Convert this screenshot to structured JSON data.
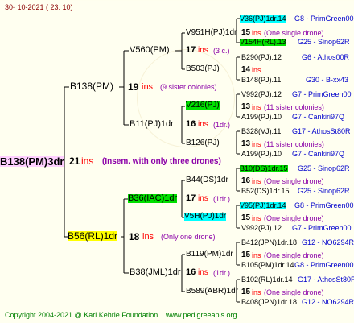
{
  "header": {
    "date": "30- 10-2021 ( 23: 10)"
  },
  "footer": {
    "copyright": "Copyright 2004-2021 @ Karl Kehrle Foundation",
    "site": "www.pedigreeapis.org"
  },
  "root": {
    "name": "B138(PM)3dr",
    "num": "21",
    "ins": "ins",
    "note": "(Insem. with only three drones)"
  },
  "gen1": {
    "father": {
      "name": "B138(PM)",
      "num": "19",
      "ins": "ins",
      "note": "(9 sister colonies)"
    },
    "mother": {
      "name": "B56(RL)1dr",
      "num": "18",
      "ins": "ins",
      "note": "(Only one drone)"
    }
  },
  "gen2": {
    "ff": {
      "name": "V560(PM)",
      "num": "17",
      "ins": "ins",
      "note": "(3 c.)"
    },
    "fm": {
      "name": "B11(PJ)1dr",
      "num": "16",
      "ins": "ins",
      "note": "(1dr.)"
    },
    "mf": {
      "name": "B36(IAC)1dr",
      "num": "17",
      "ins": "ins",
      "note": "(1dr.)"
    },
    "mm": {
      "name": "B38(JML)1dr",
      "num": "16",
      "ins": "ins",
      "note": "(1dr.)"
    }
  },
  "gen3": {
    "a": {
      "name": "V951H(PJ)1dr",
      "num": "15",
      "ins": "ins",
      "note": "(One single drone)"
    },
    "b": {
      "name": "B503(PJ)",
      "num": "14",
      "ins": "ins",
      "note": ""
    },
    "c": {
      "name": "V216(PJ)",
      "num": "13",
      "ins": "ins",
      "note": "(11 sister colonies)"
    },
    "d": {
      "name": "B126(PJ)",
      "num": "13",
      "ins": "ins",
      "note": "(11 sister colonies)"
    },
    "e": {
      "name": "B44(DS)1dr",
      "num": "16",
      "ins": "ins",
      "note": "(One single drone)"
    },
    "f": {
      "name": "V5H(PJ)1dr",
      "num": "15",
      "ins": "ins",
      "note": "(One single drone)"
    },
    "g": {
      "name": "B119(PM)1dr",
      "num": "15",
      "ins": "ins",
      "note": "(One single drone)"
    },
    "h": {
      "name": "B589(ABR)1dr",
      "num": "15",
      "ins": "ins",
      "note": "(One single drone)"
    }
  },
  "gen4": [
    {
      "name": "V36(PJ)1dr.14",
      "org": "G8 - PrimGreen00"
    },
    {
      "name": "V154H(RL).13",
      "org": "G25 - Sinop62R"
    },
    {
      "name": "B290(PJ).12",
      "org": "G6 - Athos00R"
    },
    {
      "name": "B148(PJ).11",
      "org": "G30 - B-xx43"
    },
    {
      "name": "V992(PJ).12",
      "org": "G7 - PrimGreen00"
    },
    {
      "name": "A199(PJ).10",
      "org": "G7 - Cankiri97Q"
    },
    {
      "name": "B328(VJ).11",
      "org": "G17 - AthosSt80R"
    },
    {
      "name": "A199(PJ).10",
      "org": "G7 - Cankiri97Q"
    },
    {
      "name": "B10(DS)1dr.15",
      "org": "G25 - Sinop62R"
    },
    {
      "name": "B52(DS)1dr.15",
      "org": "G25 - Sinop62R"
    },
    {
      "name": "V95(PJ)1dr.14",
      "org": "G8 - PrimGreen00"
    },
    {
      "name": "V992(PJ).12",
      "org": "G7 - PrimGreen00"
    },
    {
      "name": "B412(JPN)1dr.18",
      "org": "G12 - NO6294R"
    },
    {
      "name": "B105(PM)1dr.14",
      "org": "G8 - PrimGreen00"
    },
    {
      "name": "B102(RL)1dr.14",
      "org": "G17 - AthosSt80R"
    },
    {
      "name": "B408(JPN)1dr.18",
      "org": "G12 - NO6294R"
    }
  ]
}
